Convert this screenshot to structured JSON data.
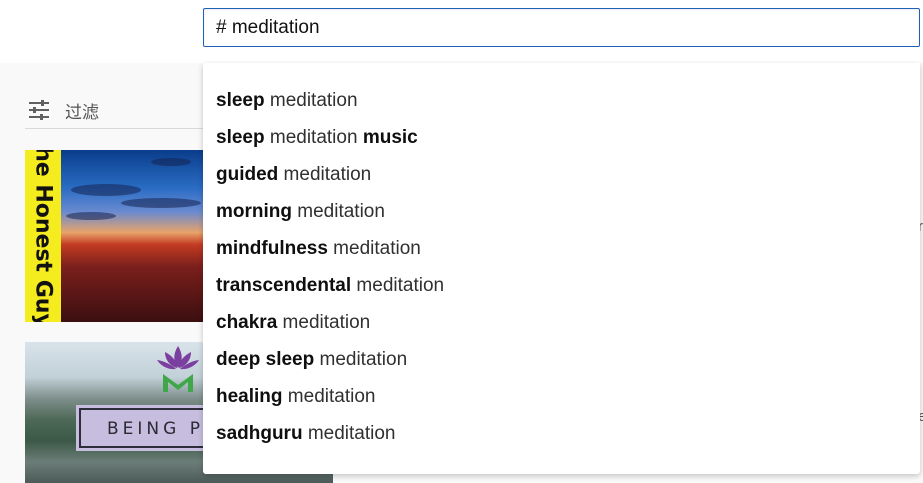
{
  "search": {
    "query": "# meditation"
  },
  "filter": {
    "label": "过滤"
  },
  "thumbnails": [
    {
      "channel_text": "The Honest Guys"
    },
    {
      "plaque_text": "BEING PRE"
    }
  ],
  "suggestions": [
    {
      "bold_prefix": "sleep",
      "middle": " meditation",
      "bold_suffix": ""
    },
    {
      "bold_prefix": "sleep",
      "middle": " meditation ",
      "bold_suffix": "music"
    },
    {
      "bold_prefix": "guided",
      "middle": " meditation",
      "bold_suffix": ""
    },
    {
      "bold_prefix": "morning",
      "middle": " meditation",
      "bold_suffix": ""
    },
    {
      "bold_prefix": "mindfulness",
      "middle": " meditation",
      "bold_suffix": ""
    },
    {
      "bold_prefix": "transcendental",
      "middle": " meditation",
      "bold_suffix": ""
    },
    {
      "bold_prefix": "chakra",
      "middle": " meditation",
      "bold_suffix": ""
    },
    {
      "bold_prefix": "deep sleep",
      "middle": " meditation",
      "bold_suffix": ""
    },
    {
      "bold_prefix": "healing",
      "middle": " meditation",
      "bold_suffix": ""
    },
    {
      "bold_prefix": "sadhguru",
      "middle": " meditation",
      "bold_suffix": ""
    }
  ],
  "colors": {
    "search_border": "#1c62b9",
    "band_yellow": "#f4ec1f",
    "plaque": "#c7bddf"
  }
}
